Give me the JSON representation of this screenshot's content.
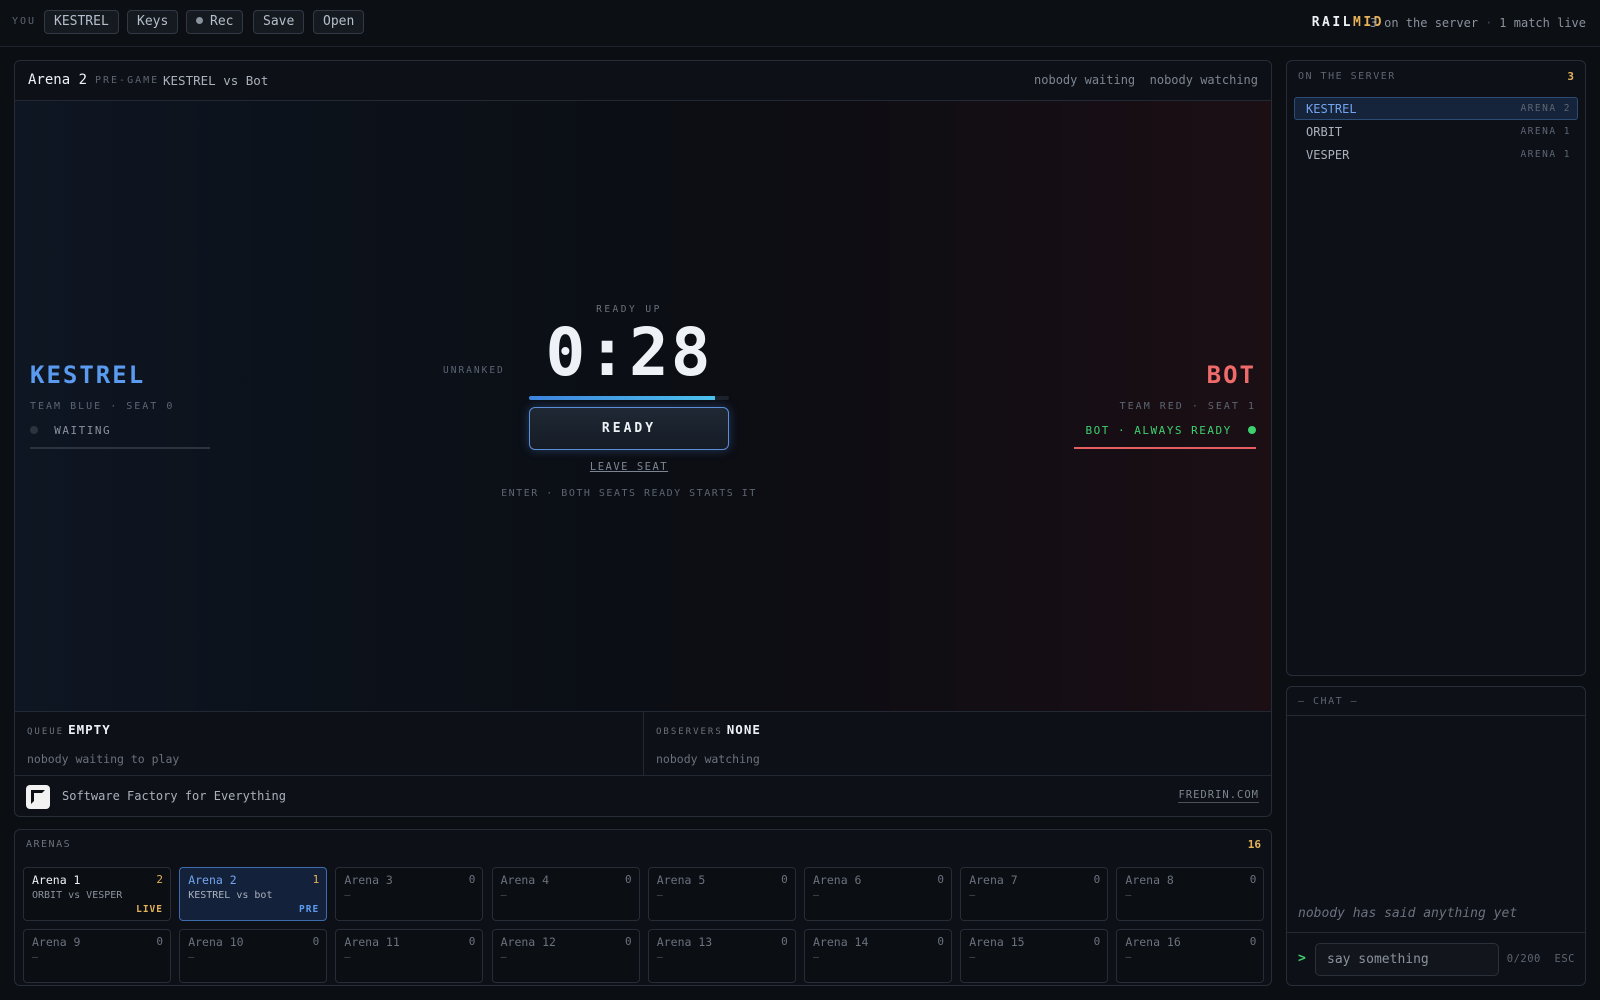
{
  "topbar": {
    "you_label": "YOU",
    "buttons": {
      "name": "KESTREL",
      "keys": "Keys",
      "rec": "Rec",
      "save": "Save",
      "open": "Open"
    },
    "brand_a": "RAIL",
    "brand_b": "MID",
    "brand_a_color": "#eef2f6",
    "brand_b_color": "#e5b25a",
    "online": "3 on the server",
    "separator": "·",
    "live": "1 match live"
  },
  "arena": {
    "title": "Arena 2",
    "phase": "PRE-GAME",
    "matchup": "KESTREL vs Bot",
    "waiting": "nobody waiting",
    "watching": "nobody watching"
  },
  "left_player": {
    "name": "KESTREL",
    "meta": "TEAM BLUE · SEAT 0",
    "status": "WAITING",
    "color": "#5a9bf0",
    "status_dot": "#2e343d",
    "status_text_color": "#8a929d",
    "underline": "#2e343d"
  },
  "right_player": {
    "name": "BOT",
    "meta": "TEAM RED · SEAT 1",
    "status": "BOT · ALWAYS READY",
    "color": "#ef6a6a",
    "status_dot": "#3ecf6e",
    "status_text_color": "#3ecf6e",
    "underline": "#e55e60"
  },
  "center": {
    "unranked": "UNRANKED",
    "ready_up": "READY UP",
    "timer": "0:28",
    "progress_fraction": 0.93,
    "ready_button": "READY",
    "leave_seat": "LEAVE SEAT",
    "hint": "ENTER · BOTH SEATS READY STARTS IT"
  },
  "queue": {
    "label": "QUEUE",
    "value": "EMPTY",
    "sub": "nobody waiting to play"
  },
  "observers": {
    "label": "OBSERVERS",
    "value": "NONE",
    "sub": "nobody watching"
  },
  "footer": {
    "tagline": "Software Factory for Everything",
    "link": "FREDRIN.COM",
    "logo_icon": "logo-mark-icon"
  },
  "arenas": {
    "label": "ARENAS",
    "count": "16",
    "cards": [
      {
        "name": "Arena 1",
        "count": "2",
        "sub": "ORBIT vs VESPER",
        "tag": "LIVE",
        "tag_color": "#e5b25a",
        "state": "on"
      },
      {
        "name": "Arena 2",
        "count": "1",
        "sub": "KESTREL vs bot",
        "tag": "PRE",
        "tag_color": "#5a9bf0",
        "state": "sel"
      },
      {
        "name": "Arena 3",
        "count": "0",
        "sub": "–",
        "tag": "",
        "state": ""
      },
      {
        "name": "Arena 4",
        "count": "0",
        "sub": "–",
        "tag": "",
        "state": ""
      },
      {
        "name": "Arena 5",
        "count": "0",
        "sub": "–",
        "tag": "",
        "state": ""
      },
      {
        "name": "Arena 6",
        "count": "0",
        "sub": "–",
        "tag": "",
        "state": ""
      },
      {
        "name": "Arena 7",
        "count": "0",
        "sub": "–",
        "tag": "",
        "state": ""
      },
      {
        "name": "Arena 8",
        "count": "0",
        "sub": "–",
        "tag": "",
        "state": ""
      },
      {
        "name": "Arena 9",
        "count": "0",
        "sub": "–",
        "tag": "",
        "state": ""
      },
      {
        "name": "Arena 10",
        "count": "0",
        "sub": "–",
        "tag": "",
        "state": ""
      },
      {
        "name": "Arena 11",
        "count": "0",
        "sub": "–",
        "tag": "",
        "state": ""
      },
      {
        "name": "Arena 12",
        "count": "0",
        "sub": "–",
        "tag": "",
        "state": ""
      },
      {
        "name": "Arena 13",
        "count": "0",
        "sub": "–",
        "tag": "",
        "state": ""
      },
      {
        "name": "Arena 14",
        "count": "0",
        "sub": "–",
        "tag": "",
        "state": ""
      },
      {
        "name": "Arena 15",
        "count": "0",
        "sub": "–",
        "tag": "",
        "state": ""
      },
      {
        "name": "Arena 16",
        "count": "0",
        "sub": "–",
        "tag": "",
        "state": ""
      }
    ]
  },
  "server": {
    "label": "ON THE SERVER",
    "count": "3",
    "players": [
      {
        "name": "KESTREL",
        "arena": "ARENA 2",
        "me": true
      },
      {
        "name": "ORBIT",
        "arena": "ARENA 1",
        "me": false
      },
      {
        "name": "VESPER",
        "arena": "ARENA 1",
        "me": false
      }
    ]
  },
  "chat": {
    "label": "— CHAT —",
    "empty": "nobody has said anything yet",
    "prompt": ">",
    "placeholder": "say something",
    "counter": "0/200",
    "esc": "ESC"
  }
}
